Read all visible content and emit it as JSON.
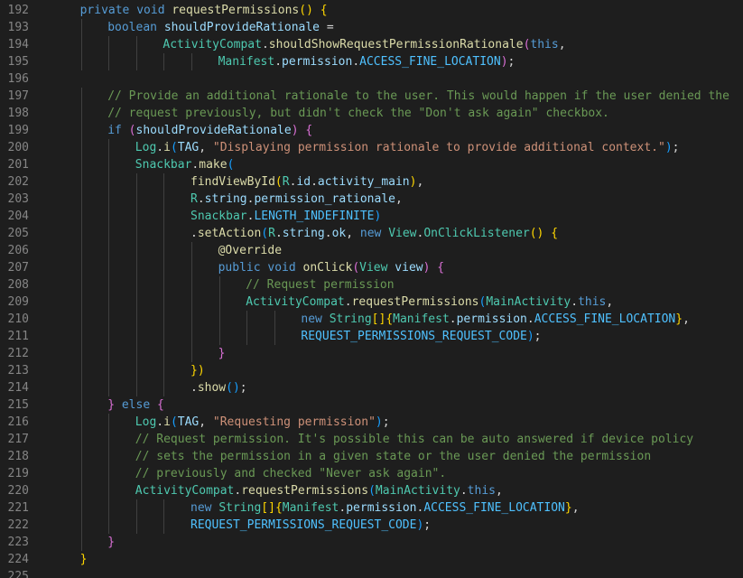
{
  "editor": {
    "lines": [
      {
        "n": "192",
        "i": 1,
        "t": [
          [
            "kw",
            "private "
          ],
          [
            "kw",
            "void "
          ],
          [
            "fn",
            "requestPermissions"
          ],
          [
            "b1",
            "() {"
          ]
        ]
      },
      {
        "n": "193",
        "i": 2,
        "t": [
          [
            "kw",
            "boolean "
          ],
          [
            "id",
            "shouldProvideRationale"
          ],
          [
            "pn",
            " ="
          ]
        ]
      },
      {
        "n": "194",
        "i": 4,
        "t": [
          [
            "ty",
            "ActivityCompat"
          ],
          [
            "pn",
            "."
          ],
          [
            "fn",
            "shouldShowRequestPermissionRationale"
          ],
          [
            "b2",
            "("
          ],
          [
            "kw",
            "this"
          ],
          [
            "pn",
            ","
          ]
        ]
      },
      {
        "n": "195",
        "i": 6,
        "t": [
          [
            "ty",
            "Manifest"
          ],
          [
            "pn",
            "."
          ],
          [
            "id",
            "permission"
          ],
          [
            "pn",
            "."
          ],
          [
            "cs",
            "ACCESS_FINE_LOCATION"
          ],
          [
            "b2",
            ")"
          ],
          [
            "pn",
            ";"
          ]
        ]
      },
      {
        "n": "196",
        "i": 0,
        "t": []
      },
      {
        "n": "197",
        "i": 2,
        "t": [
          [
            "cm",
            "// Provide an additional rationale to the user. This would happen if the user denied the"
          ]
        ]
      },
      {
        "n": "198",
        "i": 2,
        "t": [
          [
            "cm",
            "// request previously, but didn't check the \"Don't ask again\" checkbox."
          ]
        ]
      },
      {
        "n": "199",
        "i": 2,
        "t": [
          [
            "kw",
            "if "
          ],
          [
            "b2",
            "("
          ],
          [
            "id",
            "shouldProvideRationale"
          ],
          [
            "b2",
            ")"
          ],
          [
            "b2",
            " {"
          ]
        ]
      },
      {
        "n": "200",
        "i": 3,
        "t": [
          [
            "ty",
            "Log"
          ],
          [
            "pn",
            "."
          ],
          [
            "fn",
            "i"
          ],
          [
            "b3",
            "("
          ],
          [
            "id",
            "TAG"
          ],
          [
            "pn",
            ", "
          ],
          [
            "st",
            "\"Displaying permission rationale to provide additional context.\""
          ],
          [
            "b3",
            ")"
          ],
          [
            "pn",
            ";"
          ]
        ]
      },
      {
        "n": "201",
        "i": 3,
        "t": [
          [
            "ty",
            "Snackbar"
          ],
          [
            "pn",
            "."
          ],
          [
            "fn",
            "make"
          ],
          [
            "b3",
            "("
          ]
        ]
      },
      {
        "n": "202",
        "i": 5,
        "t": [
          [
            "fn",
            "findViewById"
          ],
          [
            "b1",
            "("
          ],
          [
            "ty",
            "R"
          ],
          [
            "pn",
            "."
          ],
          [
            "id",
            "id"
          ],
          [
            "pn",
            "."
          ],
          [
            "id",
            "activity_main"
          ],
          [
            "b1",
            ")"
          ],
          [
            "pn",
            ","
          ]
        ]
      },
      {
        "n": "203",
        "i": 5,
        "t": [
          [
            "ty",
            "R"
          ],
          [
            "pn",
            "."
          ],
          [
            "id",
            "string"
          ],
          [
            "pn",
            "."
          ],
          [
            "id",
            "permission_rationale"
          ],
          [
            "pn",
            ","
          ]
        ]
      },
      {
        "n": "204",
        "i": 5,
        "t": [
          [
            "ty",
            "Snackbar"
          ],
          [
            "pn",
            "."
          ],
          [
            "cs",
            "LENGTH_INDEFINITE"
          ],
          [
            "b3",
            ")"
          ]
        ]
      },
      {
        "n": "205",
        "i": 5,
        "t": [
          [
            "pn",
            "."
          ],
          [
            "fn",
            "setAction"
          ],
          [
            "b3",
            "("
          ],
          [
            "ty",
            "R"
          ],
          [
            "pn",
            "."
          ],
          [
            "id",
            "string"
          ],
          [
            "pn",
            "."
          ],
          [
            "id",
            "ok"
          ],
          [
            "pn",
            ", "
          ],
          [
            "kw",
            "new "
          ],
          [
            "ty",
            "View"
          ],
          [
            "pn",
            "."
          ],
          [
            "ty",
            "OnClickListener"
          ],
          [
            "b1",
            "() {"
          ]
        ]
      },
      {
        "n": "206",
        "i": 6,
        "t": [
          [
            "an",
            "@Override"
          ]
        ]
      },
      {
        "n": "207",
        "i": 6,
        "t": [
          [
            "kw",
            "public "
          ],
          [
            "kw",
            "void "
          ],
          [
            "fn",
            "onClick"
          ],
          [
            "b2",
            "("
          ],
          [
            "ty",
            "View "
          ],
          [
            "id",
            "view"
          ],
          [
            "b2",
            ")"
          ],
          [
            "b2",
            " {"
          ]
        ]
      },
      {
        "n": "208",
        "i": 7,
        "t": [
          [
            "cm",
            "// Request permission"
          ]
        ]
      },
      {
        "n": "209",
        "i": 7,
        "t": [
          [
            "ty",
            "ActivityCompat"
          ],
          [
            "pn",
            "."
          ],
          [
            "fn",
            "requestPermissions"
          ],
          [
            "b3",
            "("
          ],
          [
            "ty",
            "MainActivity"
          ],
          [
            "pn",
            "."
          ],
          [
            "kw",
            "this"
          ],
          [
            "pn",
            ","
          ]
        ]
      },
      {
        "n": "210",
        "i": 9,
        "t": [
          [
            "kw",
            "new "
          ],
          [
            "ty",
            "String"
          ],
          [
            "b1",
            "[]"
          ],
          [
            "b1",
            "{"
          ],
          [
            "ty",
            "Manifest"
          ],
          [
            "pn",
            "."
          ],
          [
            "id",
            "permission"
          ],
          [
            "pn",
            "."
          ],
          [
            "cs",
            "ACCESS_FINE_LOCATION"
          ],
          [
            "b1",
            "}"
          ],
          [
            "pn",
            ","
          ]
        ]
      },
      {
        "n": "211",
        "i": 9,
        "t": [
          [
            "cs",
            "REQUEST_PERMISSIONS_REQUEST_CODE"
          ],
          [
            "b3",
            ")"
          ],
          [
            "pn",
            ";"
          ]
        ]
      },
      {
        "n": "212",
        "i": 6,
        "t": [
          [
            "b2",
            "}"
          ]
        ]
      },
      {
        "n": "213",
        "i": 5,
        "t": [
          [
            "b1",
            "})"
          ]
        ]
      },
      {
        "n": "214",
        "i": 5,
        "t": [
          [
            "pn",
            "."
          ],
          [
            "fn",
            "show"
          ],
          [
            "b3",
            "()"
          ],
          [
            "pn",
            ";"
          ]
        ]
      },
      {
        "n": "215",
        "i": 2,
        "t": [
          [
            "b2",
            "} "
          ],
          [
            "kw",
            "else "
          ],
          [
            "b2",
            "{"
          ]
        ]
      },
      {
        "n": "216",
        "i": 3,
        "t": [
          [
            "ty",
            "Log"
          ],
          [
            "pn",
            "."
          ],
          [
            "fn",
            "i"
          ],
          [
            "b3",
            "("
          ],
          [
            "id",
            "TAG"
          ],
          [
            "pn",
            ", "
          ],
          [
            "st",
            "\"Requesting permission\""
          ],
          [
            "b3",
            ")"
          ],
          [
            "pn",
            ";"
          ]
        ]
      },
      {
        "n": "217",
        "i": 3,
        "t": [
          [
            "cm",
            "// Request permission. It's possible this can be auto answered if device policy"
          ]
        ]
      },
      {
        "n": "218",
        "i": 3,
        "t": [
          [
            "cm",
            "// sets the permission in a given state or the user denied the permission"
          ]
        ]
      },
      {
        "n": "219",
        "i": 3,
        "t": [
          [
            "cm",
            "// previously and checked \"Never ask again\"."
          ]
        ]
      },
      {
        "n": "220",
        "i": 3,
        "t": [
          [
            "ty",
            "ActivityCompat"
          ],
          [
            "pn",
            "."
          ],
          [
            "fn",
            "requestPermissions"
          ],
          [
            "b3",
            "("
          ],
          [
            "ty",
            "MainActivity"
          ],
          [
            "pn",
            "."
          ],
          [
            "kw",
            "this"
          ],
          [
            "pn",
            ","
          ]
        ]
      },
      {
        "n": "221",
        "i": 5,
        "t": [
          [
            "kw",
            "new "
          ],
          [
            "ty",
            "String"
          ],
          [
            "b1",
            "[]"
          ],
          [
            "b1",
            "{"
          ],
          [
            "ty",
            "Manifest"
          ],
          [
            "pn",
            "."
          ],
          [
            "id",
            "permission"
          ],
          [
            "pn",
            "."
          ],
          [
            "cs",
            "ACCESS_FINE_LOCATION"
          ],
          [
            "b1",
            "}"
          ],
          [
            "pn",
            ","
          ]
        ]
      },
      {
        "n": "222",
        "i": 5,
        "t": [
          [
            "cs",
            "REQUEST_PERMISSIONS_REQUEST_CODE"
          ],
          [
            "b3",
            ")"
          ],
          [
            "pn",
            ";"
          ]
        ]
      },
      {
        "n": "223",
        "i": 2,
        "t": [
          [
            "b2",
            "}"
          ]
        ]
      },
      {
        "n": "224",
        "i": 1,
        "t": [
          [
            "b1",
            "}"
          ]
        ]
      },
      {
        "n": "225",
        "i": 0,
        "t": []
      }
    ]
  }
}
